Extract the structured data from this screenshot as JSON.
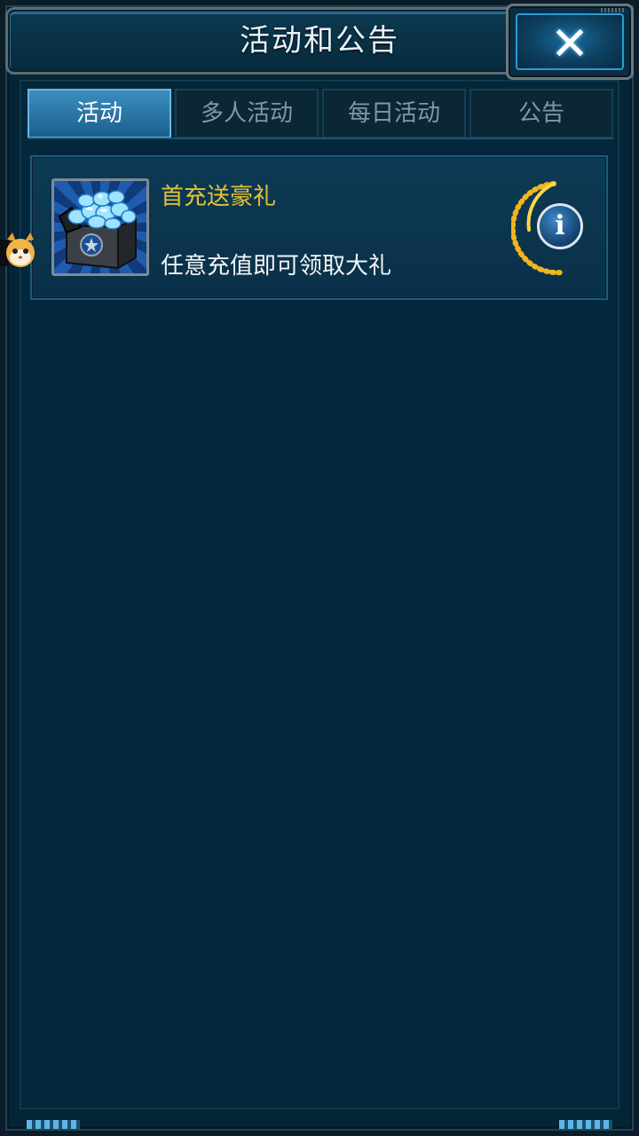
{
  "window": {
    "title": "活动和公告",
    "close_label": "✕"
  },
  "tabs": [
    {
      "label": "活动",
      "active": true
    },
    {
      "label": "多人活动",
      "active": false
    },
    {
      "label": "每日活动",
      "active": false
    },
    {
      "label": "公告",
      "active": false
    }
  ],
  "activities": [
    {
      "title": "首充送豪礼",
      "description": "任意充值即可领取大礼",
      "icon": "diamond-chest-icon",
      "info_label": "i"
    }
  ],
  "colors": {
    "background": "#03202f",
    "title_text": "#e8f2f7",
    "active_tab": "#3a8ec0",
    "activity_title": "#e3c236",
    "activity_desc": "#f2f5f7"
  }
}
